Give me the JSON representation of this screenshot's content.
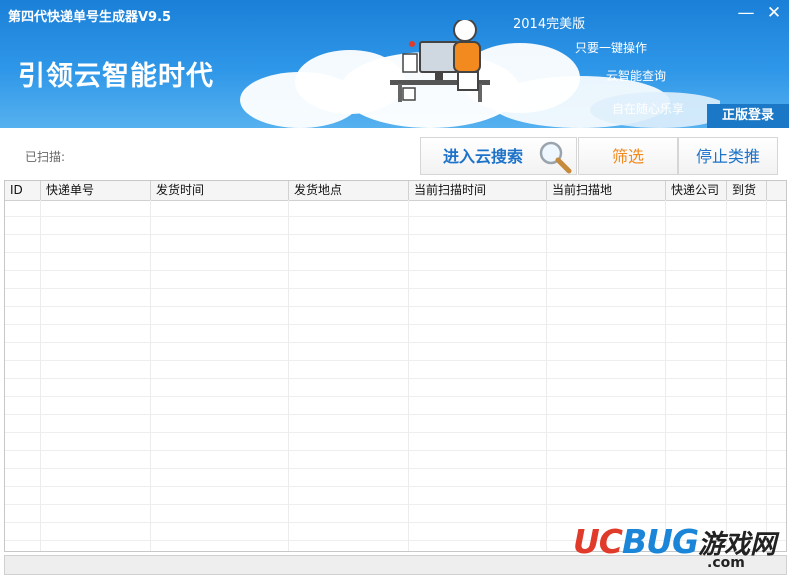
{
  "window": {
    "title": "第四代快递单号生成器V9.5",
    "minimize_glyph": "—",
    "close_glyph": "✕"
  },
  "banner": {
    "slogan": "引领云智能时代",
    "edition": "2014完美版",
    "taglines": [
      "只要一键操作",
      "云智能查询",
      "自在随心乐享"
    ],
    "login_label": "正版登录",
    "colors": {
      "banner_top": "#1a80d8",
      "banner_bottom": "#56b1ef",
      "login_bg": "#1b78c6"
    }
  },
  "toolbar": {
    "scanned_label": "已扫描:",
    "search_label": "进入云搜索",
    "filter_label": "筛选",
    "stop_label": "停止类推",
    "colors": {
      "search": "#1e73c9",
      "filter": "#f28a1f",
      "stop": "#1e73c9"
    }
  },
  "table": {
    "columns": [
      "ID",
      "快递单号",
      "发货时间",
      "发货地点",
      "当前扫描时间",
      "当前扫描地",
      "快递公司",
      "到货"
    ],
    "rows": []
  },
  "watermark": {
    "brand_uc": "UC",
    "brand_bug": "BUG",
    "brand_cn": "游戏网",
    "domain": ".com"
  }
}
